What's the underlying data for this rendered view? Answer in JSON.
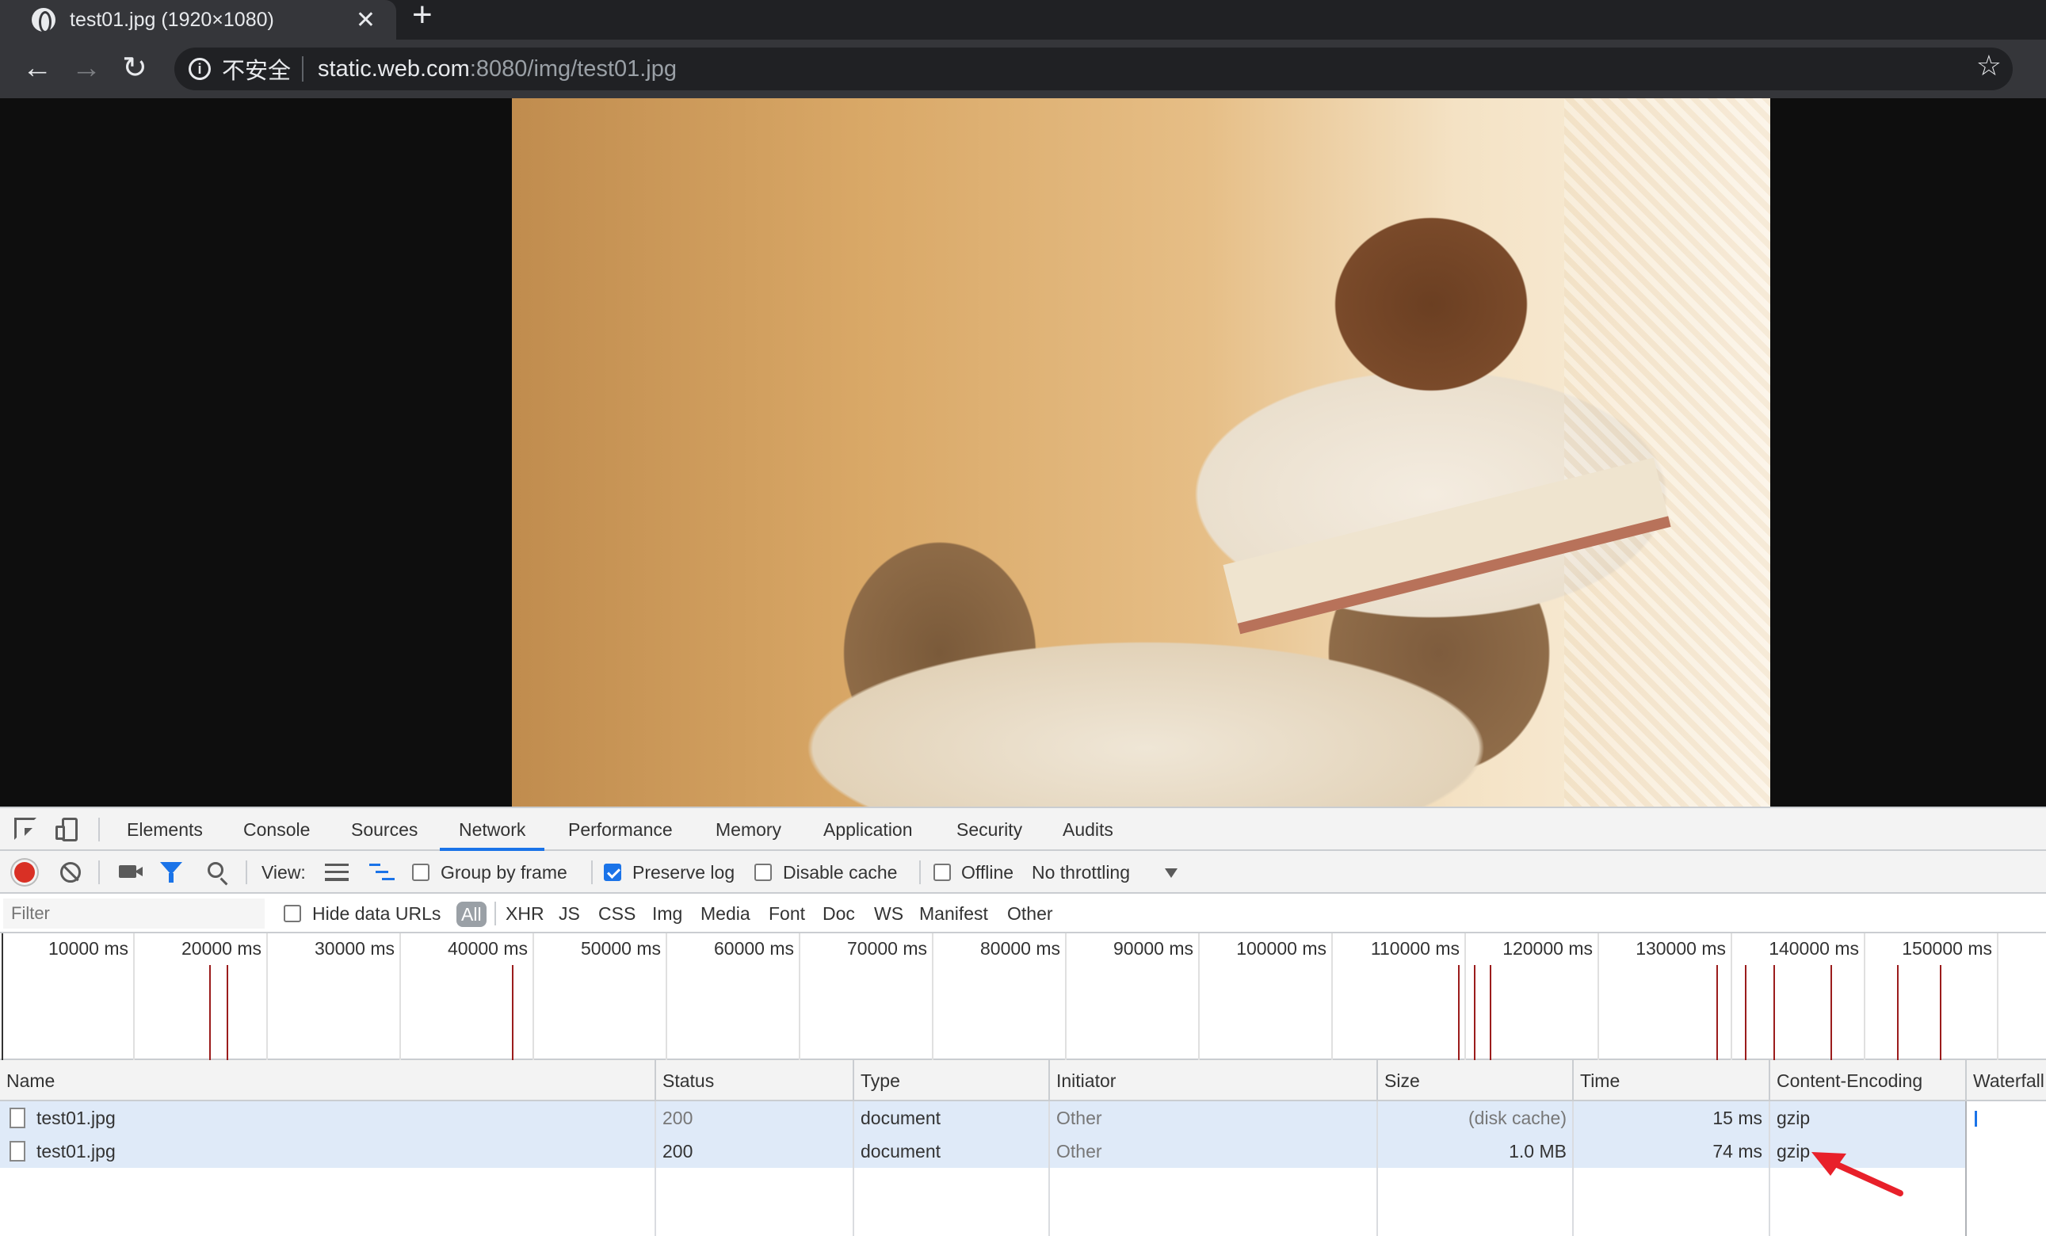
{
  "browser": {
    "tab": {
      "title": "test01.jpg (1920×1080)",
      "close_glyph": "✕",
      "new_tab_glyph": "+"
    },
    "nav": {
      "back_glyph": "←",
      "forward_glyph": "→",
      "reload_glyph": "↻"
    },
    "omnibox": {
      "info_glyph": "i",
      "security_label": "不安全",
      "url_host": "static.web.com",
      "url_rest": ":8080/img/test01.jpg",
      "star_glyph": "☆"
    }
  },
  "devtools": {
    "tabs": [
      "Elements",
      "Console",
      "Sources",
      "Network",
      "Performance",
      "Memory",
      "Application",
      "Security",
      "Audits"
    ],
    "active_tab": "Network",
    "toolbar": {
      "view_label": "View:",
      "group_by_frame": {
        "label": "Group by frame",
        "checked": false
      },
      "preserve_log": {
        "label": "Preserve log",
        "checked": true
      },
      "disable_cache": {
        "label": "Disable cache",
        "checked": false
      },
      "offline": {
        "label": "Offline",
        "checked": false
      },
      "throttling": "No throttling"
    },
    "filter": {
      "placeholder": "Filter",
      "hide_data_urls": {
        "label": "Hide data URLs",
        "checked": false
      },
      "types": [
        "All",
        "XHR",
        "JS",
        "CSS",
        "Img",
        "Media",
        "Font",
        "Doc",
        "WS",
        "Manifest",
        "Other"
      ],
      "active_type": "All"
    },
    "overview": {
      "tick_labels": [
        "10000 ms",
        "20000 ms",
        "30000 ms",
        "40000 ms",
        "50000 ms",
        "60000 ms",
        "70000 ms",
        "80000 ms",
        "90000 ms",
        "100000 ms",
        "110000 ms",
        "120000 ms",
        "130000 ms",
        "140000 ms",
        "150000 ms",
        "1"
      ]
    },
    "columns": [
      "Name",
      "Status",
      "Type",
      "Initiator",
      "Size",
      "Time",
      "Content-Encoding",
      "Waterfall"
    ],
    "rows": [
      {
        "name": "test01.jpg",
        "status": "200",
        "type": "document",
        "initiator": "Other",
        "size": "(disk cache)",
        "time": "15 ms",
        "encoding": "gzip"
      },
      {
        "name": "test01.jpg",
        "status": "200",
        "type": "document",
        "initiator": "Other",
        "size": "1.0 MB",
        "time": "74 ms",
        "encoding": "gzip"
      }
    ]
  },
  "colors": {
    "accent": "#1a73e8",
    "record": "#d93025",
    "annotation_arrow": "#e8202a",
    "selected_row": "#dfeaf8"
  }
}
